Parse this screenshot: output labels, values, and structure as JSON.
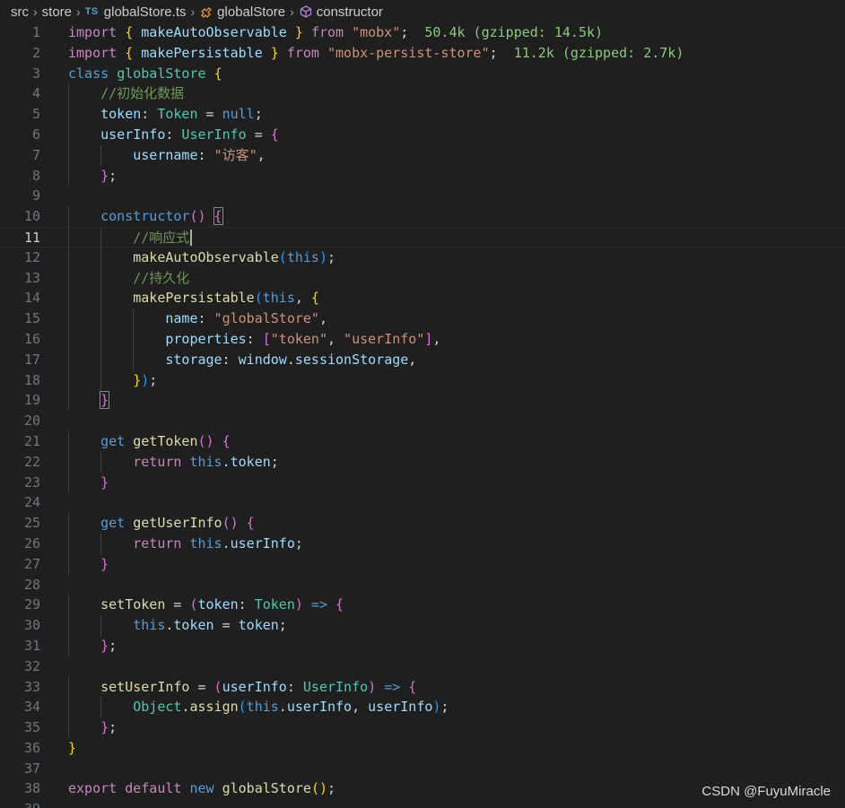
{
  "breadcrumb": {
    "items": [
      "src",
      "store",
      "globalStore.ts",
      "globalStore",
      "constructor"
    ],
    "file_badge": "TS"
  },
  "lines": [
    {
      "n": "1",
      "indent": 0,
      "tokens": [
        [
          "import",
          "k1"
        ],
        [
          " ",
          "pun"
        ],
        [
          "{",
          "br1"
        ],
        [
          " makeAutoObservable ",
          "var"
        ],
        [
          "}",
          "br1"
        ],
        [
          " ",
          "pun"
        ],
        [
          "from",
          "k1"
        ],
        [
          " ",
          "pun"
        ],
        [
          "\"mobx\"",
          "str"
        ],
        [
          ";",
          "pun"
        ],
        [
          "  50.4k (gzipped: 14.5k)",
          "size"
        ]
      ]
    },
    {
      "n": "2",
      "indent": 0,
      "tokens": [
        [
          "import",
          "k1"
        ],
        [
          " ",
          "pun"
        ],
        [
          "{",
          "br1"
        ],
        [
          " makePersistable ",
          "var"
        ],
        [
          "}",
          "br1"
        ],
        [
          " ",
          "pun"
        ],
        [
          "from",
          "k1"
        ],
        [
          " ",
          "pun"
        ],
        [
          "\"mobx-persist-store\"",
          "str"
        ],
        [
          ";",
          "pun"
        ],
        [
          "  11.2k (gzipped: 2.7k)",
          "size"
        ]
      ]
    },
    {
      "n": "3",
      "indent": 0,
      "tokens": [
        [
          "class",
          "k2"
        ],
        [
          " ",
          "pun"
        ],
        [
          "globalStore",
          "typ"
        ],
        [
          " ",
          "pun"
        ],
        [
          "{",
          "br1"
        ]
      ]
    },
    {
      "n": "4",
      "indent": 1,
      "tokens": [
        [
          "//初始化数据",
          "cm"
        ]
      ]
    },
    {
      "n": "5",
      "indent": 1,
      "tokens": [
        [
          "token",
          "var"
        ],
        [
          ": ",
          "pun"
        ],
        [
          "Token",
          "typ"
        ],
        [
          " = ",
          "pun"
        ],
        [
          "null",
          "k2"
        ],
        [
          ";",
          "pun"
        ]
      ]
    },
    {
      "n": "6",
      "indent": 1,
      "tokens": [
        [
          "userInfo",
          "var"
        ],
        [
          ": ",
          "pun"
        ],
        [
          "UserInfo",
          "typ"
        ],
        [
          " = ",
          "pun"
        ],
        [
          "{",
          "br2"
        ]
      ]
    },
    {
      "n": "7",
      "indent": 2,
      "tokens": [
        [
          "username",
          "var"
        ],
        [
          ": ",
          "pun"
        ],
        [
          "\"访客\"",
          "str"
        ],
        [
          ",",
          "pun"
        ]
      ]
    },
    {
      "n": "8",
      "indent": 1,
      "tokens": [
        [
          "}",
          "br2"
        ],
        [
          ";",
          "pun"
        ]
      ]
    },
    {
      "n": "9",
      "indent": 0,
      "tokens": []
    },
    {
      "n": "10",
      "indent": 1,
      "tokens": [
        [
          "constructor",
          "k2"
        ],
        [
          "()",
          "br2"
        ],
        [
          " ",
          "pun"
        ],
        [
          "{",
          "br2box"
        ]
      ]
    },
    {
      "n": "11",
      "indent": 2,
      "active": true,
      "tokens": [
        [
          "//响应式",
          "cm"
        ],
        [
          "|",
          "cursor"
        ]
      ]
    },
    {
      "n": "12",
      "indent": 2,
      "tokens": [
        [
          "makeAutoObservable",
          "fn"
        ],
        [
          "(",
          "br3"
        ],
        [
          "this",
          "k2"
        ],
        [
          ")",
          "br3"
        ],
        [
          ";",
          "pun"
        ]
      ]
    },
    {
      "n": "13",
      "indent": 2,
      "tokens": [
        [
          "//持久化",
          "cm"
        ]
      ]
    },
    {
      "n": "14",
      "indent": 2,
      "tokens": [
        [
          "makePersistable",
          "fn"
        ],
        [
          "(",
          "br3"
        ],
        [
          "this",
          "k2"
        ],
        [
          ", ",
          "pun"
        ],
        [
          "{",
          "br1"
        ]
      ]
    },
    {
      "n": "15",
      "indent": 3,
      "tokens": [
        [
          "name",
          "var"
        ],
        [
          ": ",
          "pun"
        ],
        [
          "\"globalStore\"",
          "str"
        ],
        [
          ",",
          "pun"
        ]
      ]
    },
    {
      "n": "16",
      "indent": 3,
      "tokens": [
        [
          "properties",
          "var"
        ],
        [
          ": ",
          "pun"
        ],
        [
          "[",
          "br2"
        ],
        [
          "\"token\"",
          "str"
        ],
        [
          ", ",
          "pun"
        ],
        [
          "\"userInfo\"",
          "str"
        ],
        [
          "]",
          "br2"
        ],
        [
          ",",
          "pun"
        ]
      ]
    },
    {
      "n": "17",
      "indent": 3,
      "tokens": [
        [
          "storage",
          "var"
        ],
        [
          ": ",
          "pun"
        ],
        [
          "window",
          "var"
        ],
        [
          ".",
          "pun"
        ],
        [
          "sessionStorage",
          "var"
        ],
        [
          ",",
          "pun"
        ]
      ]
    },
    {
      "n": "18",
      "indent": 2,
      "tokens": [
        [
          "}",
          "br1"
        ],
        [
          ")",
          "br3"
        ],
        [
          ";",
          "pun"
        ]
      ]
    },
    {
      "n": "19",
      "indent": 1,
      "tokens": [
        [
          "}",
          "br2box"
        ]
      ]
    },
    {
      "n": "20",
      "indent": 0,
      "tokens": []
    },
    {
      "n": "21",
      "indent": 1,
      "tokens": [
        [
          "get",
          "k2"
        ],
        [
          " ",
          "pun"
        ],
        [
          "getToken",
          "fn"
        ],
        [
          "()",
          "br2"
        ],
        [
          " ",
          "pun"
        ],
        [
          "{",
          "br2"
        ]
      ]
    },
    {
      "n": "22",
      "indent": 2,
      "tokens": [
        [
          "return",
          "k1"
        ],
        [
          " ",
          "pun"
        ],
        [
          "this",
          "k2"
        ],
        [
          ".",
          "pun"
        ],
        [
          "token",
          "var"
        ],
        [
          ";",
          "pun"
        ]
      ]
    },
    {
      "n": "23",
      "indent": 1,
      "tokens": [
        [
          "}",
          "br2"
        ]
      ]
    },
    {
      "n": "24",
      "indent": 0,
      "tokens": []
    },
    {
      "n": "25",
      "indent": 1,
      "tokens": [
        [
          "get",
          "k2"
        ],
        [
          " ",
          "pun"
        ],
        [
          "getUserInfo",
          "fn"
        ],
        [
          "()",
          "br2"
        ],
        [
          " ",
          "pun"
        ],
        [
          "{",
          "br2"
        ]
      ]
    },
    {
      "n": "26",
      "indent": 2,
      "tokens": [
        [
          "return",
          "k1"
        ],
        [
          " ",
          "pun"
        ],
        [
          "this",
          "k2"
        ],
        [
          ".",
          "pun"
        ],
        [
          "userInfo",
          "var"
        ],
        [
          ";",
          "pun"
        ]
      ]
    },
    {
      "n": "27",
      "indent": 1,
      "tokens": [
        [
          "}",
          "br2"
        ]
      ]
    },
    {
      "n": "28",
      "indent": 0,
      "tokens": []
    },
    {
      "n": "29",
      "indent": 1,
      "tokens": [
        [
          "setToken",
          "fn"
        ],
        [
          " = ",
          "pun"
        ],
        [
          "(",
          "br2"
        ],
        [
          "token",
          "var"
        ],
        [
          ": ",
          "pun"
        ],
        [
          "Token",
          "typ"
        ],
        [
          ")",
          "br2"
        ],
        [
          " ",
          "pun"
        ],
        [
          "=>",
          "k2"
        ],
        [
          " ",
          "pun"
        ],
        [
          "{",
          "br2"
        ]
      ]
    },
    {
      "n": "30",
      "indent": 2,
      "tokens": [
        [
          "this",
          "k2"
        ],
        [
          ".",
          "pun"
        ],
        [
          "token",
          "var"
        ],
        [
          " = ",
          "pun"
        ],
        [
          "token",
          "var"
        ],
        [
          ";",
          "pun"
        ]
      ]
    },
    {
      "n": "31",
      "indent": 1,
      "tokens": [
        [
          "}",
          "br2"
        ],
        [
          ";",
          "pun"
        ]
      ]
    },
    {
      "n": "32",
      "indent": 0,
      "tokens": []
    },
    {
      "n": "33",
      "indent": 1,
      "tokens": [
        [
          "setUserInfo",
          "fn"
        ],
        [
          " = ",
          "pun"
        ],
        [
          "(",
          "br2"
        ],
        [
          "userInfo",
          "var"
        ],
        [
          ": ",
          "pun"
        ],
        [
          "UserInfo",
          "typ"
        ],
        [
          ")",
          "br2"
        ],
        [
          " ",
          "pun"
        ],
        [
          "=>",
          "k2"
        ],
        [
          " ",
          "pun"
        ],
        [
          "{",
          "br2"
        ]
      ]
    },
    {
      "n": "34",
      "indent": 2,
      "tokens": [
        [
          "Object",
          "typ"
        ],
        [
          ".",
          "pun"
        ],
        [
          "assign",
          "fn"
        ],
        [
          "(",
          "br3"
        ],
        [
          "this",
          "k2"
        ],
        [
          ".",
          "pun"
        ],
        [
          "userInfo",
          "var"
        ],
        [
          ", ",
          "pun"
        ],
        [
          "userInfo",
          "var"
        ],
        [
          ")",
          "br3"
        ],
        [
          ";",
          "pun"
        ]
      ]
    },
    {
      "n": "35",
      "indent": 1,
      "tokens": [
        [
          "}",
          "br2"
        ],
        [
          ";",
          "pun"
        ]
      ]
    },
    {
      "n": "36",
      "indent": 0,
      "tokens": [
        [
          "}",
          "br1"
        ]
      ]
    },
    {
      "n": "37",
      "indent": 0,
      "tokens": []
    },
    {
      "n": "38",
      "indent": 0,
      "tokens": [
        [
          "export",
          "k1"
        ],
        [
          " ",
          "pun"
        ],
        [
          "default",
          "k1"
        ],
        [
          " ",
          "pun"
        ],
        [
          "new",
          "k2"
        ],
        [
          " ",
          "pun"
        ],
        [
          "globalStore",
          "fn"
        ],
        [
          "()",
          "br1"
        ],
        [
          ";",
          "pun"
        ]
      ]
    },
    {
      "n": "39",
      "indent": 0,
      "tokens": []
    }
  ],
  "watermark": "CSDN @FuyuMiracle"
}
